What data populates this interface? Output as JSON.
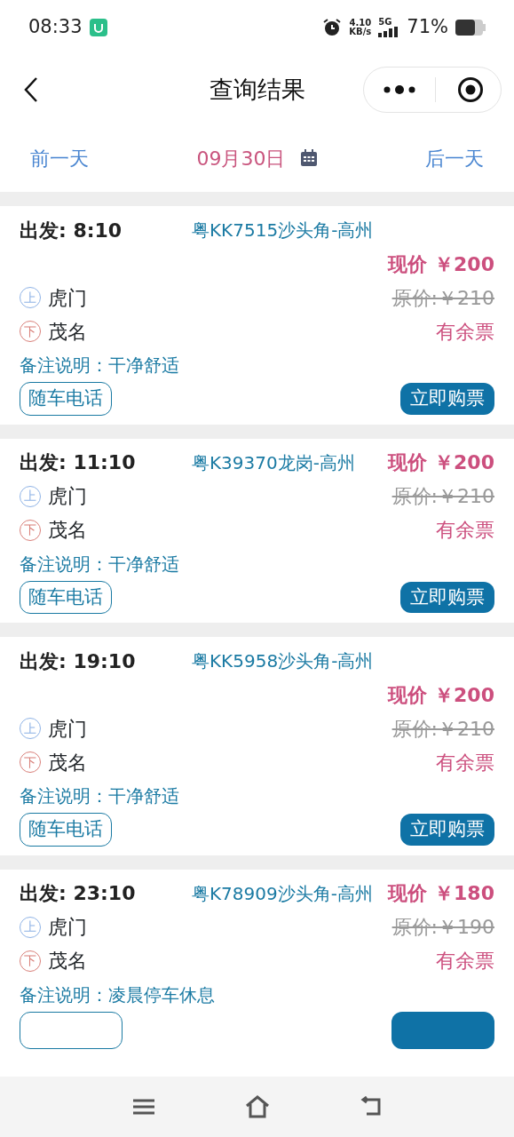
{
  "status_bar": {
    "time": "08:33",
    "speed": "4.10",
    "speed_unit": "KB/s",
    "network": "5G",
    "battery": "71%"
  },
  "header": {
    "title": "查询结果"
  },
  "date_bar": {
    "prev": "前一天",
    "date": "09月30日",
    "next": "后一天"
  },
  "trips": [
    {
      "heading": {
        "depart": "出发: 8:10",
        "route": "粤KK7515沙头角-高州"
      },
      "price": "现价 ￥200",
      "original_price": "原价:￥210",
      "board": "虎门",
      "board_tag": "上",
      "alight": "茂名",
      "alight_tag": "下",
      "availability": "有余票",
      "note": "备注说明：干净舒适",
      "phone_button": "随车电话",
      "buy_button": "立即购票"
    },
    {
      "heading": {
        "depart": "出发: 11:10",
        "route": "粤K39370龙岗-高州",
        "price": "现价 ￥200"
      },
      "original_price": "原价:￥210",
      "board": "虎门",
      "board_tag": "上",
      "alight": "茂名",
      "alight_tag": "下",
      "availability": "有余票",
      "note": "备注说明：干净舒适",
      "phone_button": "随车电话",
      "buy_button": "立即购票"
    },
    {
      "heading": {
        "depart": "出发: 19:10",
        "route": "粤KK5958沙头角-高州"
      },
      "price": "现价 ￥200",
      "original_price": "原价:￥210",
      "board": "虎门",
      "board_tag": "上",
      "alight": "茂名",
      "alight_tag": "下",
      "availability": "有余票",
      "note": "备注说明：干净舒适",
      "phone_button": "随车电话",
      "buy_button": "立即购票"
    },
    {
      "heading": {
        "depart": "出发: 23:10",
        "route": "粤K78909沙头角-高州",
        "price": "现价 ￥180"
      },
      "original_price": "原价:￥190",
      "board": "虎门",
      "board_tag": "上",
      "alight": "茂名",
      "alight_tag": "下",
      "availability": "有余票",
      "note": "备注说明：凌晨停车休息"
    }
  ]
}
